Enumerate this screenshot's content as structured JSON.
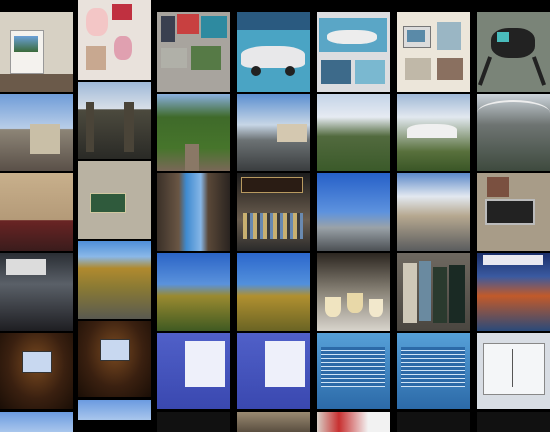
{
  "title": "",
  "tiles": [
    {
      "name": "framed-photo-poster-tile",
      "kind": "poster"
    },
    {
      "name": "cartoon-portrait-art-tile",
      "kind": "art-pink"
    },
    {
      "name": "student-artwork-board-tile",
      "kind": "art-collage"
    },
    {
      "name": "racing-car-painting-tile",
      "kind": "art-car"
    },
    {
      "name": "car-illustration-print-tile",
      "kind": "art-car2"
    },
    {
      "name": "computer-drawing-display-tile",
      "kind": "art-computer"
    },
    {
      "name": "robot-creature-sculpture-tile",
      "kind": "art-robot"
    },
    {
      "name": "historic-street-view-tile",
      "kind": "street"
    },
    {
      "name": "iron-gate-entrance-tile",
      "kind": "gate"
    },
    {
      "name": "tree-lined-path-tile",
      "kind": "trees"
    },
    {
      "name": "road-with-street-lamps-tile",
      "kind": "road"
    },
    {
      "name": "green-lawn-campus-tile",
      "kind": "lawn"
    },
    {
      "name": "white-roof-building-tile",
      "kind": "roof"
    },
    {
      "name": "canopy-structure-tile",
      "kind": "canopy"
    },
    {
      "name": "stone-shopfronts-tile",
      "kind": "shops"
    },
    {
      "name": "commemorative-plaque-tile",
      "kind": "plaque"
    },
    {
      "name": "narrow-alley-view-tile",
      "kind": "alley"
    },
    {
      "name": "whisky-shop-shelves-tile",
      "kind": "shopfront"
    },
    {
      "name": "harbour-waterfront-tile",
      "kind": "harbour"
    },
    {
      "name": "city-square-building-tile",
      "kind": "square"
    },
    {
      "name": "information-signboard-tile",
      "kind": "signboard"
    },
    {
      "name": "meeting-room-group-tile",
      "kind": "meeting"
    },
    {
      "name": "autumn-hillside-crowd-tile",
      "kind": "hill-crowd"
    },
    {
      "name": "autumn-hillside-tile",
      "kind": "hill"
    },
    {
      "name": "autumn-hill-closeup-tile",
      "kind": "hill2"
    },
    {
      "name": "whisky-tasting-glasses-tile",
      "kind": "glasses"
    },
    {
      "name": "whisky-bottles-boxes-tile",
      "kind": "bottles"
    },
    {
      "name": "tourism-leaflets-tile",
      "kind": "leaflets"
    },
    {
      "name": "lecture-hall-screen-tile",
      "kind": "lecture"
    },
    {
      "name": "lecture-hall-screen-2-tile",
      "kind": "lecture"
    },
    {
      "name": "presentation-slide-tile",
      "kind": "slide"
    },
    {
      "name": "presentation-slide-2-tile",
      "kind": "slide"
    },
    {
      "name": "code-slide-tile",
      "kind": "codeslide"
    },
    {
      "name": "code-slide-2-tile",
      "kind": "codeslide"
    },
    {
      "name": "diagram-slide-tile",
      "kind": "diagramslide"
    },
    {
      "name": "partial-sky-tile",
      "kind": "sky"
    },
    {
      "name": "partial-sky-2-tile",
      "kind": "sky"
    },
    {
      "name": "partial-dark-tile",
      "kind": "dark"
    },
    {
      "name": "partial-building-tile",
      "kind": "building"
    },
    {
      "name": "partial-sign-tile",
      "kind": "redsign"
    },
    {
      "name": "partial-blank-tile",
      "kind": "dark"
    },
    {
      "name": "partial-dark-2-tile",
      "kind": "dark"
    }
  ],
  "captions": {
    "plaque_line": "",
    "shopfront_sign": ""
  }
}
